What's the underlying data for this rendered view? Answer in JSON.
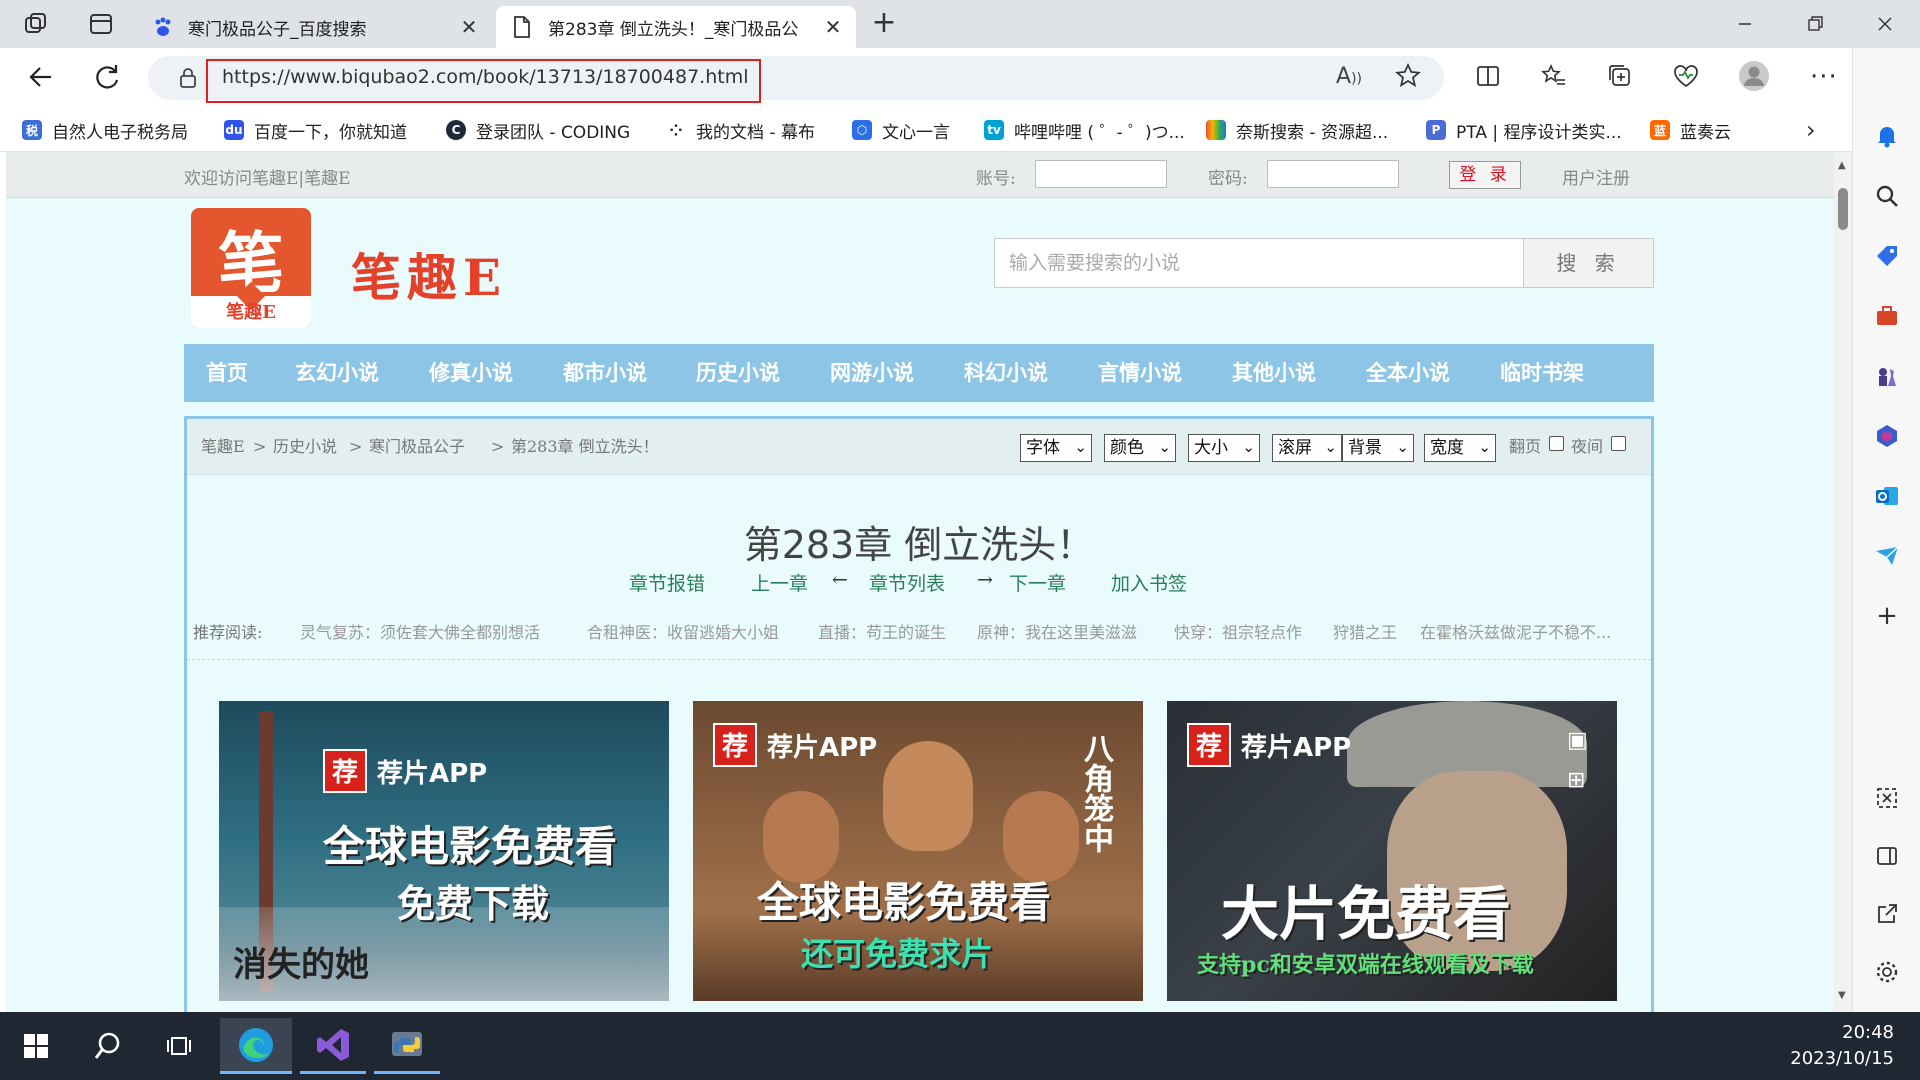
{
  "browser": {
    "tabs": [
      {
        "title": "寒门极品公子_百度搜索",
        "icon": "baidu-paw-icon",
        "active": false
      },
      {
        "title": "第283章 倒立洗头！_寒门极品公",
        "icon": "document-icon",
        "active": true
      }
    ],
    "new_tab": "+",
    "address": {
      "url": "https://www.biqubao2.com/book/13713/18700487.html"
    },
    "window_controls": [
      "minimize-icon",
      "restore-icon",
      "close-icon"
    ]
  },
  "favorites": [
    {
      "label": "自然人电子税务局",
      "icon": "tax-icon",
      "color": "#3b6fd8"
    },
    {
      "label": "百度一下，你就知道",
      "icon": "baidu-paw-icon",
      "color": "#2f54eb"
    },
    {
      "label": "登录团队 - CODING",
      "icon": "coding-icon",
      "color": "#1c2a3a"
    },
    {
      "label": "我的文档 - 幕布",
      "icon": "mubu-icon",
      "color": "#222"
    },
    {
      "label": "文心一言",
      "icon": "wenxin-icon",
      "color": "#2a6ee8"
    },
    {
      "label": "哔哩哔哩 ( ゜- ゜)つ...",
      "icon": "bilibili-icon",
      "color": "#00a1d6"
    },
    {
      "label": "奈斯搜索 - 资源超...",
      "icon": "search-colors-icon",
      "color": "#e94f2d"
    },
    {
      "label": "PTA | 程序设计类实...",
      "icon": "pta-icon",
      "color": "#4a6cd4"
    },
    {
      "label": "蓝奏云",
      "icon": "lanzou-icon",
      "color": "#ff6a00"
    }
  ],
  "site": {
    "welcome": "欢迎访问笔趣E|笔趣E",
    "account_label": "账号:",
    "password_label": "密码:",
    "login_button": "登 录",
    "register_link": "用户注册",
    "logo_char": "笔",
    "logo_caption": "笔趣E",
    "name": "笔趣E",
    "search_placeholder": "输入需要搜索的小说",
    "search_button": "搜 索",
    "nav": [
      "首页",
      "玄幻小说",
      "修真小说",
      "都市小说",
      "历史小说",
      "网游小说",
      "科幻小说",
      "言情小说",
      "其他小说",
      "全本小说",
      "临时书架"
    ],
    "breadcrumb": [
      "笔趣E",
      "历史小说",
      "寒门极品公子",
      "第283章 倒立洗头！"
    ],
    "settings": {
      "font": "字体",
      "color": "颜色",
      "size": "大小",
      "scroll": "滚屏",
      "background": "背景",
      "width": "宽度",
      "page_flip": "翻页",
      "night": "夜间"
    },
    "chapter_title": "第283章 倒立洗头！",
    "chapter_nav": {
      "report": "章节报错",
      "prev": "上一章",
      "arrow_left": "←",
      "list": "章节列表",
      "arrow_right": "→",
      "next": "下一章",
      "bookmark": "加入书签"
    },
    "recommend_label": "推荐阅读:",
    "recommend": [
      "灵气复苏：须佐套大佛全都别想活",
      "合租神医：收留逃婚大小姐",
      "直播：苟王的诞生",
      "原神：我在这里美滋滋",
      "快穿：祖宗轻点作",
      "狩猎之王",
      "在霍格沃兹做泥子不稳不..."
    ],
    "ads": [
      {
        "tag": "荐",
        "app": "荐片APP",
        "line1": "全球电影免费看",
        "line2": "免费下载",
        "extra": "消失的她"
      },
      {
        "tag": "荐",
        "app": "荐片APP",
        "line1": "全球电影免费看",
        "line2": "还可免费求片",
        "extra": "八角笼中"
      },
      {
        "tag": "荐",
        "app": "荐片APP",
        "line1": "大片免费看",
        "line2": "支持pc和安卓双端在线观看及下载",
        "extra": ""
      }
    ]
  },
  "taskbar": {
    "apps": [
      "windows-start-icon",
      "search-icon",
      "task-view-icon",
      "edge-icon",
      "visual-studio-icon",
      "python-icon"
    ],
    "time": "20:48",
    "date": "2023/10/15"
  },
  "colors": {
    "nav_bg": "#8cc5e5",
    "page_bg": "#e9fbfd",
    "brand_red": "#e4412a",
    "link_green": "#2a7f5a"
  }
}
